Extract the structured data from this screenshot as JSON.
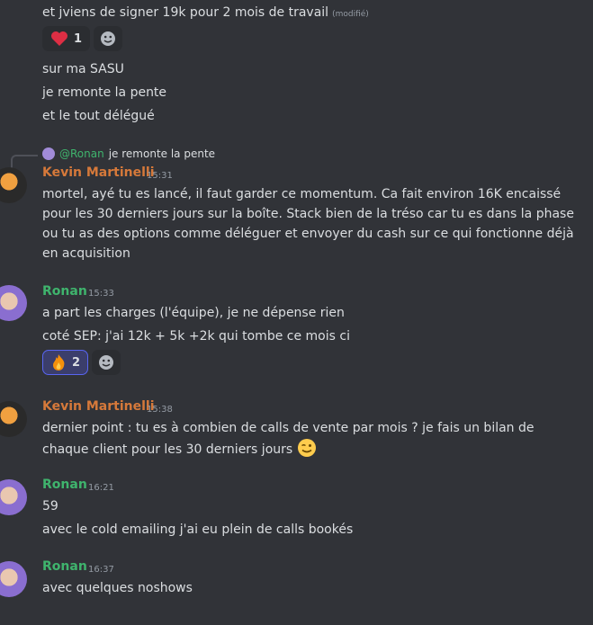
{
  "messages": {
    "m1": {
      "text": "et jviens de signer 19k pour 2 mois de travail",
      "edited": "(modifié)"
    },
    "reactions1": {
      "heart_count": "1"
    },
    "m2": "sur ma SASU",
    "m3": "je remonte la pente",
    "m4": "et le tout délégué",
    "reply": {
      "mention": "@Ronan",
      "text": "je remonte la pente"
    },
    "kevin1": {
      "author": "Kevin Martinelli",
      "time": "15:31",
      "text": "mortel, ayé tu es lancé, il faut garder ce momentum. Ca fait environ 16K encaissé pour les 30 derniers jours sur la boîte. Stack bien de la tréso car tu es dans la phase ou tu as des options comme déléguer et envoyer du cash sur ce qui fonctionne déjà en acquisition"
    },
    "ronan1": {
      "author": "Ronan",
      "time": "15:33",
      "text1": "a part les charges (l'équipe), je ne dépense rien",
      "text2": "coté SEP: j'ai 12k + 5k +2k qui tombe ce mois ci",
      "fire_count": "2"
    },
    "kevin2": {
      "author": "Kevin Martinelli",
      "time": "15:38",
      "text": "dernier point : tu es à combien de calls de vente par mois ? je fais un bilan de chaque client pour les 30 derniers jours"
    },
    "ronan2": {
      "author": "Ronan",
      "time": "16:21",
      "text1": "59",
      "text2": "avec le cold emailing j'ai eu plein de calls bookés"
    },
    "ronan3": {
      "author": "Ronan",
      "time": "16:37",
      "text": "avec quelques noshows"
    }
  },
  "colors": {
    "background": "#313338",
    "kevin": "#d6793a",
    "ronan": "#3fb46d"
  },
  "icons": [
    "heart-emoji",
    "fire-emoji",
    "add-reaction-icon",
    "wink-emoji"
  ]
}
